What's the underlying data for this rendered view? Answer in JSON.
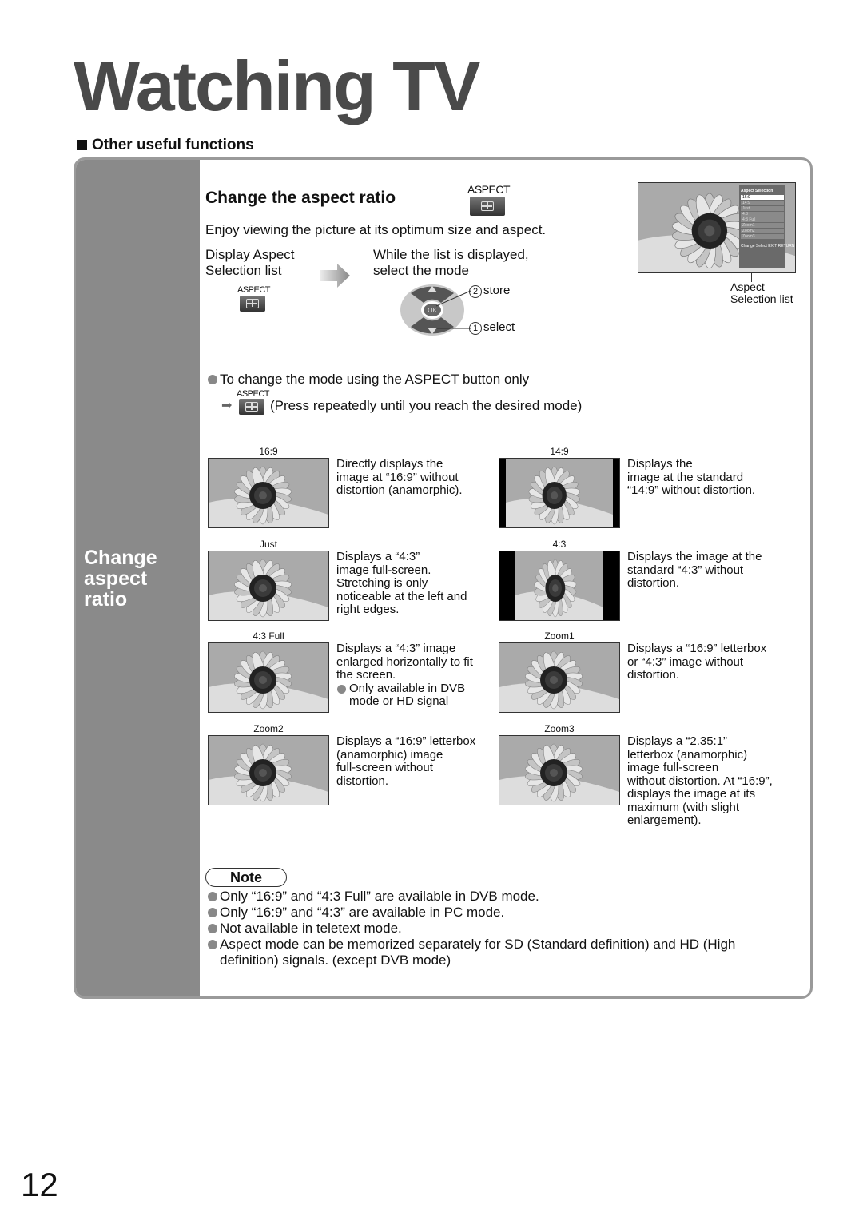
{
  "page_title": "Watching TV",
  "section": "Other useful functions",
  "sidebar_label": "Change aspect ratio",
  "heading": "Change the aspect ratio",
  "aspect_button_label": "ASPECT",
  "intro": "Enjoy viewing the picture at its optimum size and aspect.",
  "step1": {
    "line1": "Display Aspect",
    "line2": "Selection list"
  },
  "step2": {
    "line1": "While the list is displayed,",
    "line2": "select the mode",
    "store_num": "2",
    "store": "store",
    "select_num": "1",
    "select": "select",
    "ok": "OK"
  },
  "menu": {
    "title": "Aspect Selection",
    "items": [
      "16:9",
      "14:9",
      "Just",
      "4:3",
      "4:3 Full",
      "Zoom1",
      "Zoom2",
      "Zoom3"
    ],
    "change": "Change",
    "select": "Select",
    "exit": "EXIT",
    "return": "RETURN",
    "caption_line1": "Aspect",
    "caption_line2": "Selection list"
  },
  "aspect_only": {
    "text": "To change the mode using the ASPECT button only",
    "press": "(Press repeatedly until you reach the desired mode)"
  },
  "modes": [
    {
      "name": "16:9",
      "desc": [
        "Directly displays the",
        "image at “16:9” without",
        "distortion (anamorphic)."
      ]
    },
    {
      "name": "14:9",
      "desc": [
        "Displays the",
        "image at the standard",
        "“14:9” without distortion."
      ]
    },
    {
      "name": "Just",
      "desc": [
        "Displays a “4:3”",
        "image full-screen.",
        "Stretching is only",
        "noticeable at the left and",
        "right edges."
      ]
    },
    {
      "name": "4:3",
      "desc": [
        "Displays the image at the",
        "standard “4:3” without",
        "distortion."
      ]
    },
    {
      "name": "4:3 Full",
      "desc": [
        "Displays a “4:3” image",
        "enlarged horizontally to fit",
        "the screen."
      ],
      "extra": [
        "Only available in DVB",
        "mode or HD signal"
      ]
    },
    {
      "name": "Zoom1",
      "desc": [
        "Displays a “16:9” letterbox",
        "or “4:3” image without",
        "distortion."
      ]
    },
    {
      "name": "Zoom2",
      "desc": [
        "Displays a “16:9” letterbox",
        "(anamorphic) image",
        "full-screen without",
        "distortion."
      ]
    },
    {
      "name": "Zoom3",
      "desc": [
        "Displays a “2.35:1”",
        "letterbox (anamorphic)",
        "image full-screen",
        "without distortion. At “16:9”,",
        "displays the image at its",
        "maximum (with slight",
        "enlargement)."
      ]
    }
  ],
  "note": {
    "label": "Note",
    "items": [
      "Only “16:9” and “4:3 Full” are available in DVB mode.",
      "Only “16:9” and “4:3” are available in PC mode.",
      "Not available in teletext mode.",
      "Aspect mode can be memorized separately for SD (Standard definition) and HD (High",
      "definition) signals. (except DVB mode)"
    ]
  },
  "page_number": "12",
  "colors": {
    "sidebar": "#8a8a8a",
    "title": "#4a4a4a",
    "border": "#9a9a9a"
  }
}
